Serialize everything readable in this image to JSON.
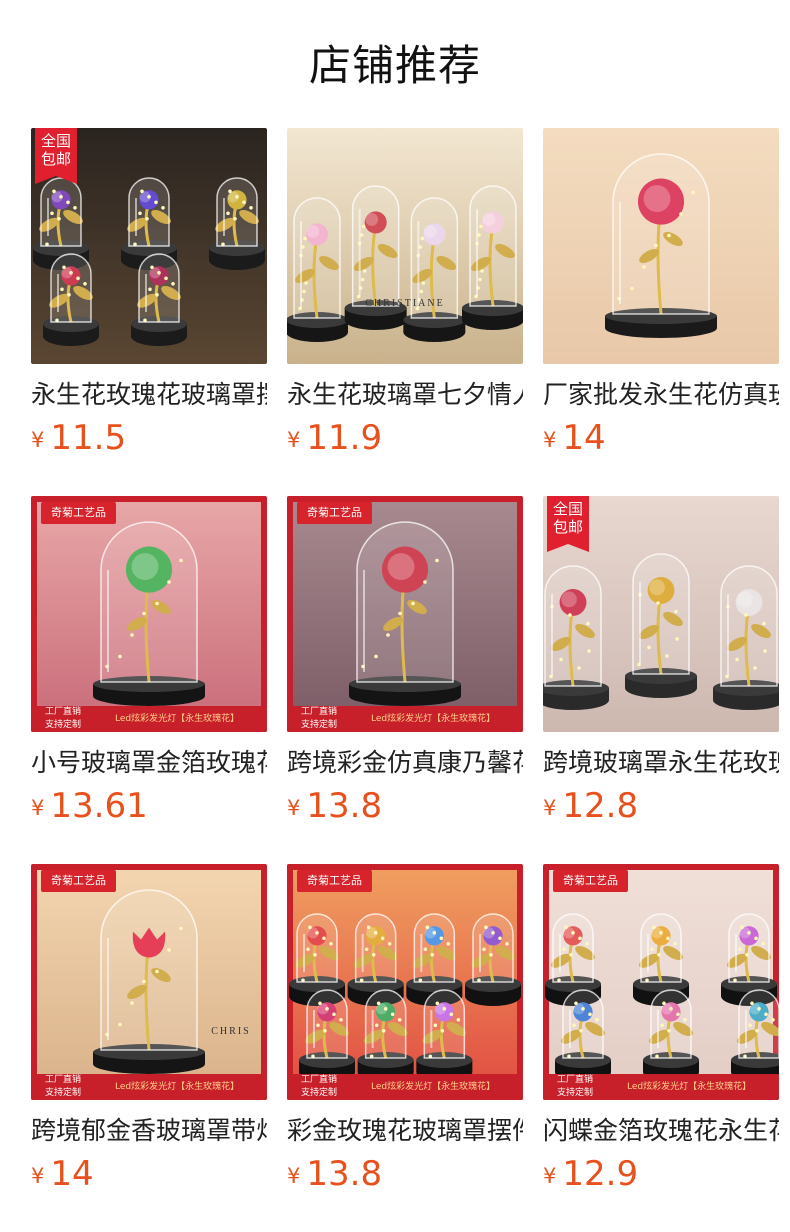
{
  "page": {
    "title": "店铺推荐"
  },
  "products": [
    {
      "name": "永生花玫瑰花玻璃罩摆件",
      "currency": "¥",
      "price": "11.5",
      "badge": "全国包邮"
    },
    {
      "name": "永生花玻璃罩七夕情人节",
      "currency": "¥",
      "price": "11.9",
      "photo_text": "CHRISTIANE"
    },
    {
      "name": "厂家批发永生花仿真玫瑰",
      "currency": "¥",
      "price": "14"
    },
    {
      "name": "小号玻璃罩金箔玫瑰花灯",
      "currency": "¥",
      "price": "13.61",
      "brand": "奇菊工艺品",
      "footer_left": "工厂直销 支持定制",
      "footer_right": "Led炫彩发光灯【永生玫瑰花】"
    },
    {
      "name": "跨境彩金仿真康乃馨花束",
      "currency": "¥",
      "price": "13.8",
      "brand": "奇菊工艺品",
      "footer_left": "工厂直销 支持定制",
      "footer_right": "Led炫彩发光灯【永生玫瑰花】"
    },
    {
      "name": "跨境玻璃罩永生花玫瑰熊",
      "currency": "¥",
      "price": "12.8",
      "badge": "全国包邮"
    },
    {
      "name": "跨境郁金香玻璃罩带灯",
      "currency": "¥",
      "price": "14",
      "brand": "奇菊工艺品",
      "footer_left": "工厂直销 支持定制",
      "footer_right": "Led炫彩发光灯【永生玫瑰花】",
      "photo_text": "CHRIS"
    },
    {
      "name": "彩金玫瑰花玻璃罩摆件",
      "currency": "¥",
      "price": "13.8",
      "brand": "奇菊工艺品",
      "footer_left": "工厂直销 支持定制",
      "footer_right": "Led炫彩发光灯【永生玫瑰花】"
    },
    {
      "name": "闪蝶金箔玫瑰花永生花",
      "currency": "¥",
      "price": "12.9",
      "brand": "奇菊工艺品",
      "footer_left": "工厂直销 支持定制",
      "footer_right": "Led炫彩发光灯【永生玫瑰花】"
    }
  ]
}
